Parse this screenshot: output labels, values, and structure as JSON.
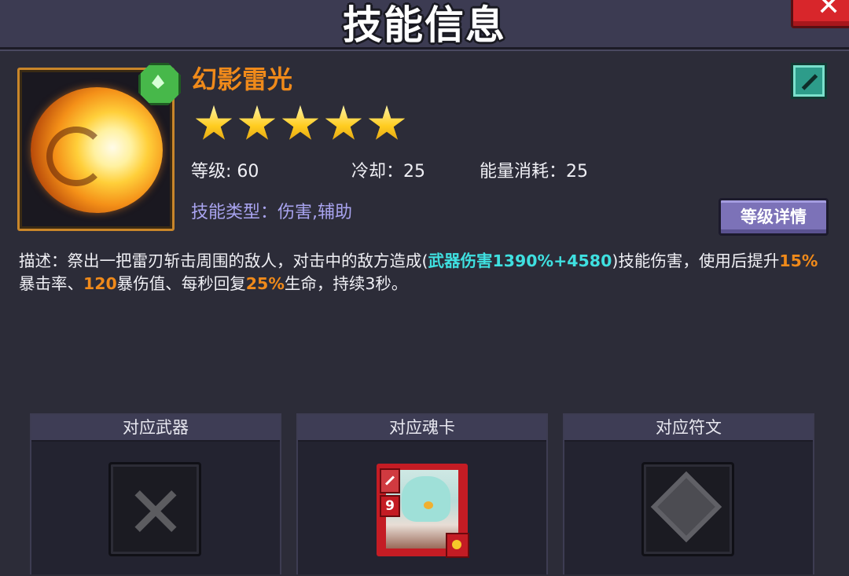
{
  "header": {
    "title": "技能信息"
  },
  "skill": {
    "name": "幻影雷光",
    "star_count": 5,
    "level_label": "等级: 60",
    "cooldown_label": "冷却：25",
    "energy_label": "能量消耗：25",
    "type_label": "技能类型：伤害,辅助",
    "level_detail_button": "等级详情"
  },
  "description": {
    "part1": "描述：祭出一把雷刃斩击周围的敌人，对击中的敌方造成(",
    "damage": "武器伤害1390%+4580",
    "part2": ")技能伤害，使用后提升",
    "crit_rate": "15%",
    "part3": "暴击率、",
    "crit_dmg": "120",
    "part4": "暴伤值、每秒回复",
    "regen": "25%",
    "part5": "生命，持续3秒。"
  },
  "cards": {
    "weapon": {
      "title": "对应武器"
    },
    "soul_card": {
      "title": "对应魂卡",
      "level": "9"
    },
    "rune": {
      "title": "对应符文"
    }
  },
  "colors": {
    "skill_name": "#f08a1a",
    "highlight_damage": "#3fe0e0",
    "highlight_value": "#f08a1a",
    "skill_type": "#a9a4f0",
    "button": "#7c72b8"
  },
  "icons": {
    "close": "close-icon",
    "weapon_type": "sword-type-icon",
    "gem": "gem-badge-icon",
    "weapon_slot": "crossed-swords-icon",
    "rune_slot": "rune-icon"
  }
}
